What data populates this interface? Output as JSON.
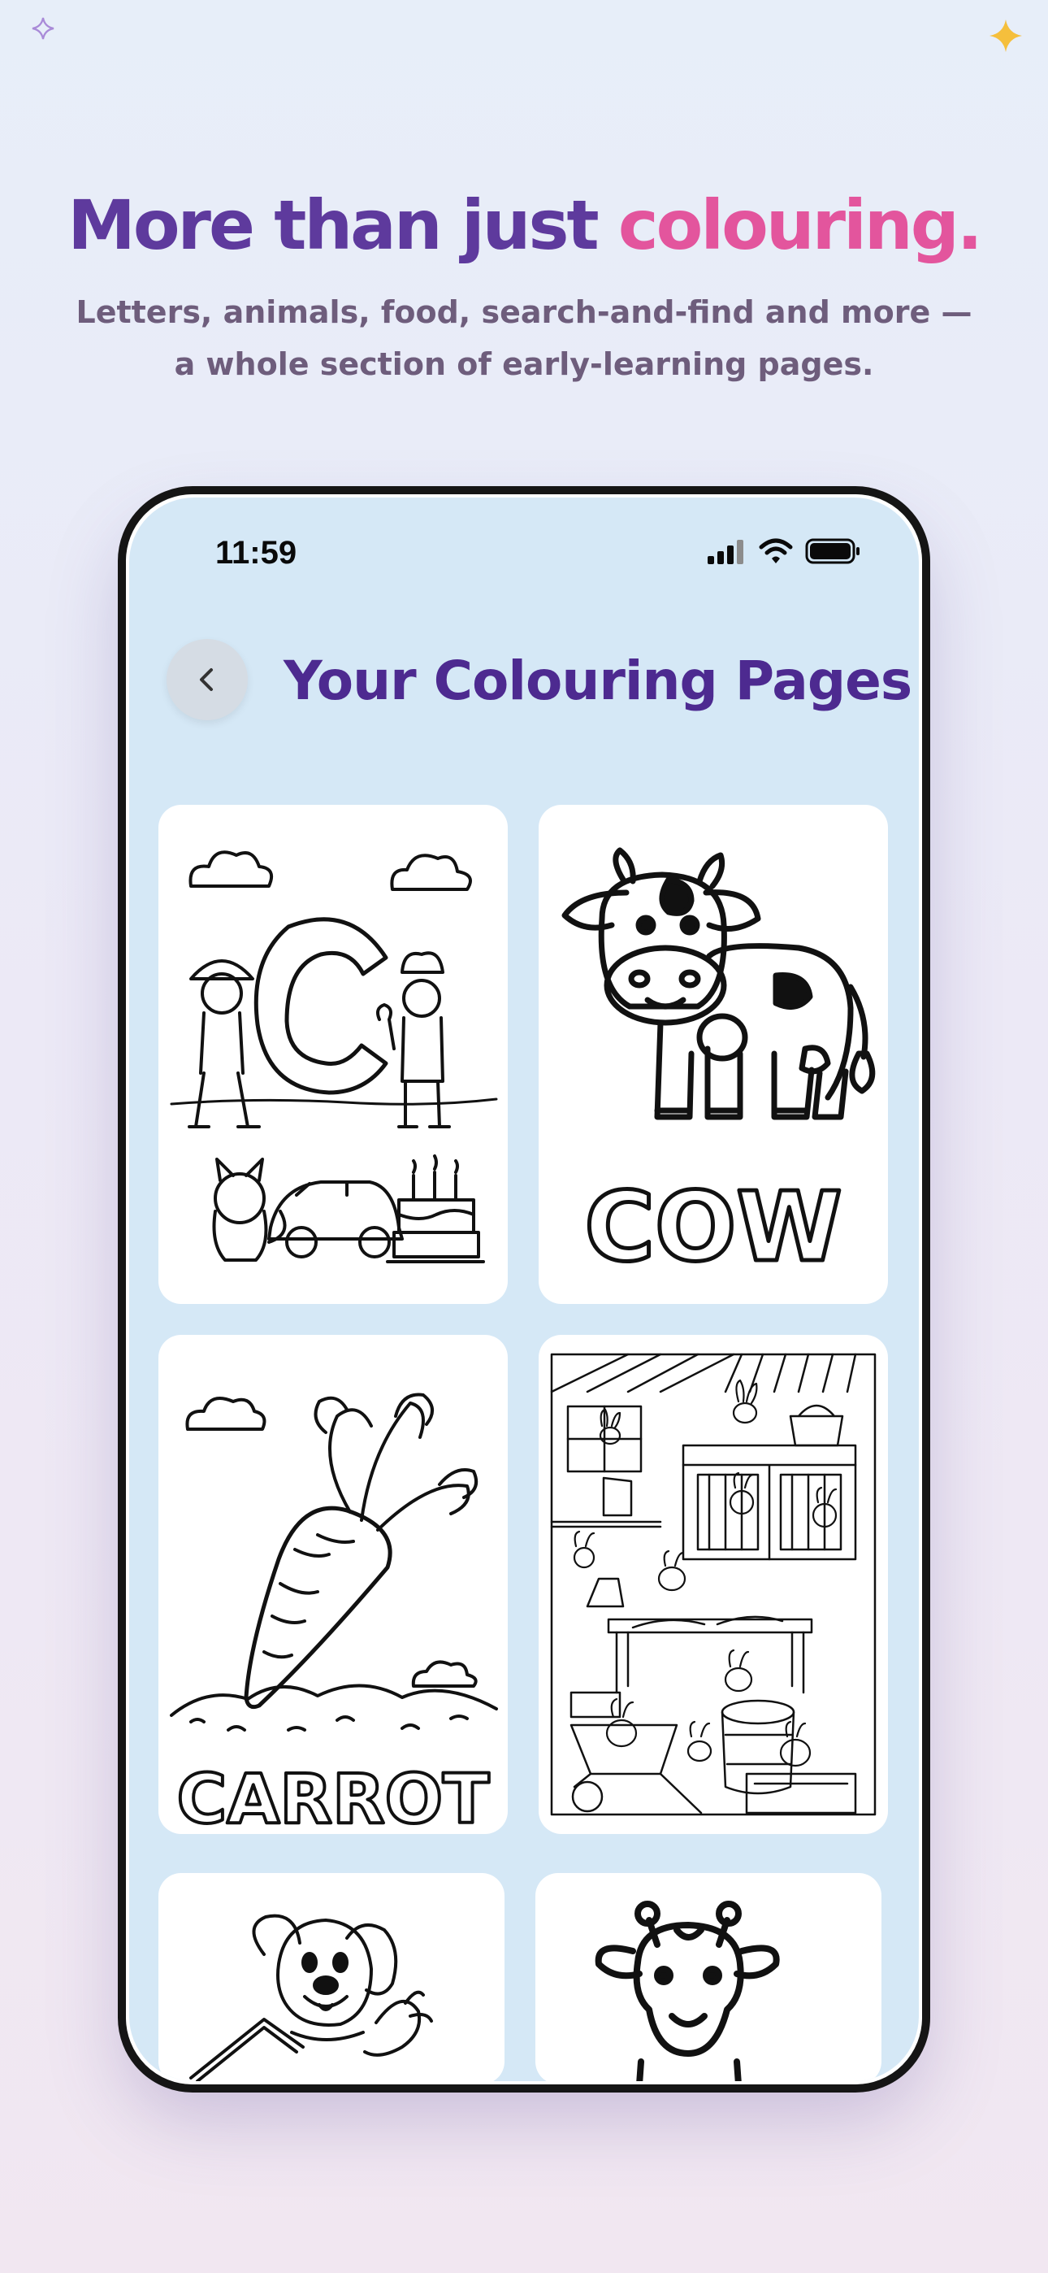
{
  "hero": {
    "headline_part1": "More than just ",
    "headline_part2": "colouring.",
    "subline_line1": "Letters, animals, food, search-and-find and more —",
    "subline_line2": "a whole section of early-learning pages."
  },
  "status_bar": {
    "time": "11:59",
    "icons": [
      "signal-icon",
      "wifi-icon",
      "battery-icon"
    ]
  },
  "screen": {
    "title": "Your Colouring Pages",
    "back_icon": "chevron-left-icon"
  },
  "pages": [
    {
      "name": "letter-c-page"
    },
    {
      "name": "cow-page",
      "word": "COW"
    },
    {
      "name": "carrot-page",
      "word": "CARROT"
    },
    {
      "name": "rabbit-barn-page"
    },
    {
      "name": "puppy-page"
    },
    {
      "name": "giraffe-page"
    }
  ],
  "colors": {
    "headline_purple": "#5e3a9d",
    "headline_pink": "#e3559d",
    "title_purple": "#4d2a90",
    "screen_bg": "#d5e8f6",
    "sparkle_gold": "#f5bf3c"
  }
}
